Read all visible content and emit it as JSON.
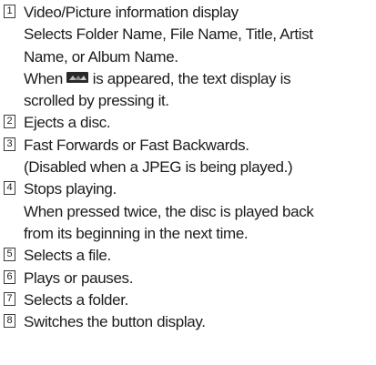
{
  "items": [
    {
      "number": "1",
      "lines": [
        "Video/Picture information display",
        "Selects Folder Name, File Name, Title, Artist",
        "Name, or Album Name."
      ],
      "icon_line": {
        "before": "When ",
        "icon": "scroll-button-icon",
        "after": " is appeared, the text display is"
      },
      "lines_after": [
        "scrolled by pressing it."
      ]
    },
    {
      "number": "2",
      "lines": [
        "Ejects a disc."
      ]
    },
    {
      "number": "3",
      "lines": [
        "Fast Forwards or Fast Backwards.",
        "(Disabled when a JPEG is being played.)"
      ]
    },
    {
      "number": "4",
      "lines": [
        "Stops playing.",
        "When pressed twice, the disc is played back",
        "from its beginning in the next time."
      ]
    },
    {
      "number": "5",
      "lines": [
        "Selects a file."
      ]
    },
    {
      "number": "6",
      "lines": [
        "Plays or pauses."
      ]
    },
    {
      "number": "7",
      "lines": [
        "Selects a folder."
      ]
    },
    {
      "number": "8",
      "lines": [
        "Switches the button display."
      ]
    }
  ]
}
